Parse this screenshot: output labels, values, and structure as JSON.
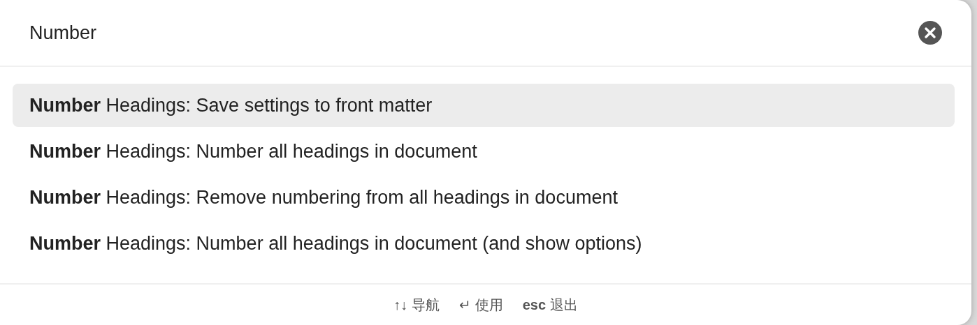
{
  "search": {
    "value": "Number"
  },
  "results": [
    {
      "text": "**Number** Headings: Save settings to front matter",
      "selected": true
    },
    {
      "text": "**Number** Headings: Number all headings in document",
      "selected": false
    },
    {
      "text": "**Number** Headings: Remove numbering from all headings in document",
      "selected": false
    },
    {
      "text": "**Number** Headings: Number all headings in document (and show options)",
      "selected": false
    }
  ],
  "footer_hints": [
    {
      "key": "↑↓",
      "label": "导航",
      "kind": "symbol"
    },
    {
      "key": "↵",
      "label": "使用",
      "kind": "symbol"
    },
    {
      "key": "esc",
      "label": "退出",
      "kind": "word"
    }
  ]
}
